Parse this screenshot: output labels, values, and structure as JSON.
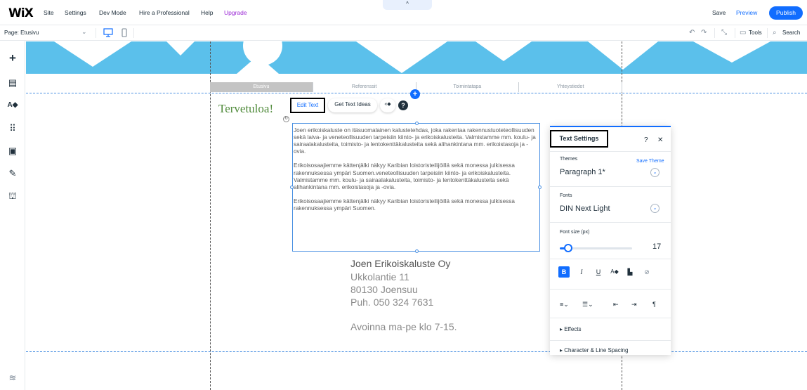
{
  "topbar": {
    "logo": "WiX",
    "menu": [
      "Site",
      "Settings",
      "Dev Mode",
      "Hire a Professional",
      "Help",
      "Upgrade"
    ],
    "handle": "^",
    "save": "Save",
    "preview": "Preview",
    "publish": "Publish"
  },
  "toolbar": {
    "page_label": "Page: Etusivu",
    "tools": "Tools",
    "search": "Search"
  },
  "nav": {
    "items": [
      "Etusivu",
      "Referenssit",
      "Toimintatapa",
      "Yhteystiedot"
    ]
  },
  "content": {
    "welcome": "Tervetuloa!",
    "edit_text": "Edit Text",
    "get_text_ideas": "Get Text Ideas",
    "paragraphs": [
      "Joen erikoiskaluste on itäsuomalainen kalustetehdas, joka rakentaa rakennustuoteteollisuuden sekä laiva- ja veneteollisuuden tarpeisiin kiinto- ja erikoiskalusteita. Valmistamme mm. koulu- ja sairaalakalusteita, toimisto- ja lentokenttäkalusteita sekä alihankintana mm. erikoistasoja ja -ovia.",
      "Erikoisosaajiemme kättenjälki näkyy Karibian loistoristeilijöillä sekä monessa julkisessa rakennuksessa ympäri Suomen.veneteollisuuden tarpeisiin kiinto- ja erikoiskalusteita. Valmistamme mm. koulu- ja sairaalakalusteita, toimisto- ja lentokenttäkalusteita sekä alihankintana mm. erikoistasoja ja -ovia.",
      "Erikoisosaajiemme kättenjälki näkyy Karibian loistoristeilijöillä sekä monessa julkisessa rakennuksessa ympäri Suomen."
    ],
    "address": [
      "Joen Erikoiskaluste Oy",
      "Ukkolantie 11",
      "80130 Joensuu",
      "Puh. 050 324 7631",
      "Avoinna ma-pe klo 7-15."
    ]
  },
  "panel": {
    "title": "Text Settings",
    "help": "?",
    "close": "✕",
    "themes_label": "Themes",
    "save_theme": "Save Theme",
    "theme_value": "Paragraph 1*",
    "fonts_label": "Fonts",
    "font_value": "DIN Next Light",
    "font_size_label": "Font size (px)",
    "font_size_value": "17",
    "font_size": 17,
    "bold": "B",
    "italic": "I",
    "underline": "U",
    "effects": "Effects",
    "spacing": "Character & Line Spacing"
  },
  "colors": {
    "accent": "#116dff",
    "header": "#5bc0eb",
    "welcome": "#4f8a3a"
  }
}
